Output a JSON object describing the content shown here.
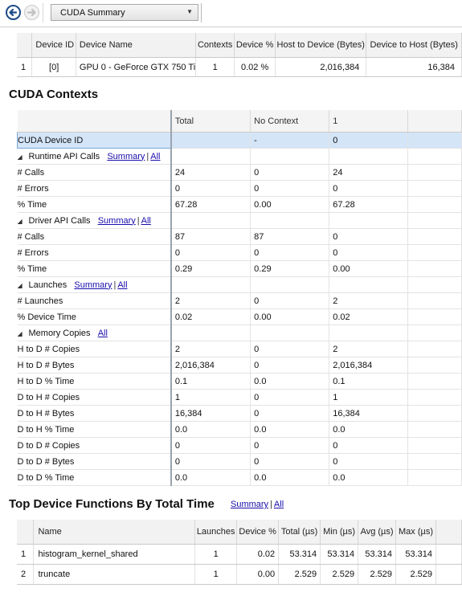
{
  "toolbar": {
    "view_selector": "CUDA Summary",
    "back_icon": "arrow-left-icon",
    "forward_icon": "arrow-right-icon"
  },
  "devices": {
    "headers": [
      "Device ID",
      "Device Name",
      "Contexts",
      "Device %",
      "Host to Device (Bytes)",
      "Device to Host (Bytes)"
    ],
    "rows": [
      {
        "index": "1",
        "device_id": "[0]",
        "device_name": "GPU 0 - GeForce GTX 750 Ti",
        "contexts": "1",
        "device_pct": "0.02 %",
        "htod": "2,016,384",
        "dtoh": "16,384"
      }
    ]
  },
  "contexts": {
    "title": "CUDA Contexts",
    "headers": [
      "Total",
      "No Context",
      "1"
    ],
    "selected_row": {
      "label": "CUDA Device ID",
      "total": "",
      "no_context": "-",
      "c1": "0"
    },
    "groups": [
      {
        "label": "Runtime API Calls",
        "links": [
          "Summary",
          "All"
        ],
        "rows": [
          {
            "label": "# Calls",
            "total": "24",
            "no_context": "0",
            "c1": "24"
          },
          {
            "label": "# Errors",
            "total": "0",
            "no_context": "0",
            "c1": "0"
          },
          {
            "label": "% Time",
            "total": "67.28",
            "no_context": "0.00",
            "c1": "67.28"
          }
        ]
      },
      {
        "label": "Driver API Calls",
        "links": [
          "Summary",
          "All"
        ],
        "rows": [
          {
            "label": "# Calls",
            "total": "87",
            "no_context": "87",
            "c1": "0"
          },
          {
            "label": "# Errors",
            "total": "0",
            "no_context": "0",
            "c1": "0"
          },
          {
            "label": "% Time",
            "total": "0.29",
            "no_context": "0.29",
            "c1": "0.00"
          }
        ]
      },
      {
        "label": "Launches",
        "links": [
          "Summary",
          "All"
        ],
        "rows": [
          {
            "label": "# Launches",
            "total": "2",
            "no_context": "0",
            "c1": "2"
          },
          {
            "label": "% Device Time",
            "total": "0.02",
            "no_context": "0.00",
            "c1": "0.02"
          }
        ]
      },
      {
        "label": "Memory Copies",
        "links": [
          "All"
        ],
        "rows": [
          {
            "label": "H to D # Copies",
            "total": "2",
            "no_context": "0",
            "c1": "2"
          },
          {
            "label": "H to D # Bytes",
            "total": "2,016,384",
            "no_context": "0",
            "c1": "2,016,384"
          },
          {
            "label": "H to D % Time",
            "total": "0.1",
            "no_context": "0.0",
            "c1": "0.1"
          },
          {
            "label": "D to H # Copies",
            "total": "1",
            "no_context": "0",
            "c1": "1"
          },
          {
            "label": "D to H # Bytes",
            "total": "16,384",
            "no_context": "0",
            "c1": "16,384"
          },
          {
            "label": "D to H % Time",
            "total": "0.0",
            "no_context": "0.0",
            "c1": "0.0"
          },
          {
            "label": "D to D # Copies",
            "total": "0",
            "no_context": "0",
            "c1": "0"
          },
          {
            "label": "D to D # Bytes",
            "total": "0",
            "no_context": "0",
            "c1": "0"
          },
          {
            "label": "D to D % Time",
            "total": "0.0",
            "no_context": "0.0",
            "c1": "0.0"
          }
        ]
      }
    ]
  },
  "top_functions": {
    "title": "Top Device Functions By Total Time",
    "links": [
      "Summary",
      "All"
    ],
    "headers": [
      "Name",
      "Launches",
      "Device %",
      "Total (µs)",
      "Min (µs)",
      "Avg (µs)",
      "Max (µs)"
    ],
    "rows": [
      {
        "index": "1",
        "name": "histogram_kernel_shared",
        "launches": "1",
        "device_pct": "0.02",
        "total": "53.314",
        "min": "53.314",
        "avg": "53.314",
        "max": "53.314"
      },
      {
        "index": "2",
        "name": "truncate",
        "launches": "1",
        "device_pct": "0.00",
        "total": "2.529",
        "min": "2.529",
        "avg": "2.529",
        "max": "2.529"
      }
    ]
  }
}
